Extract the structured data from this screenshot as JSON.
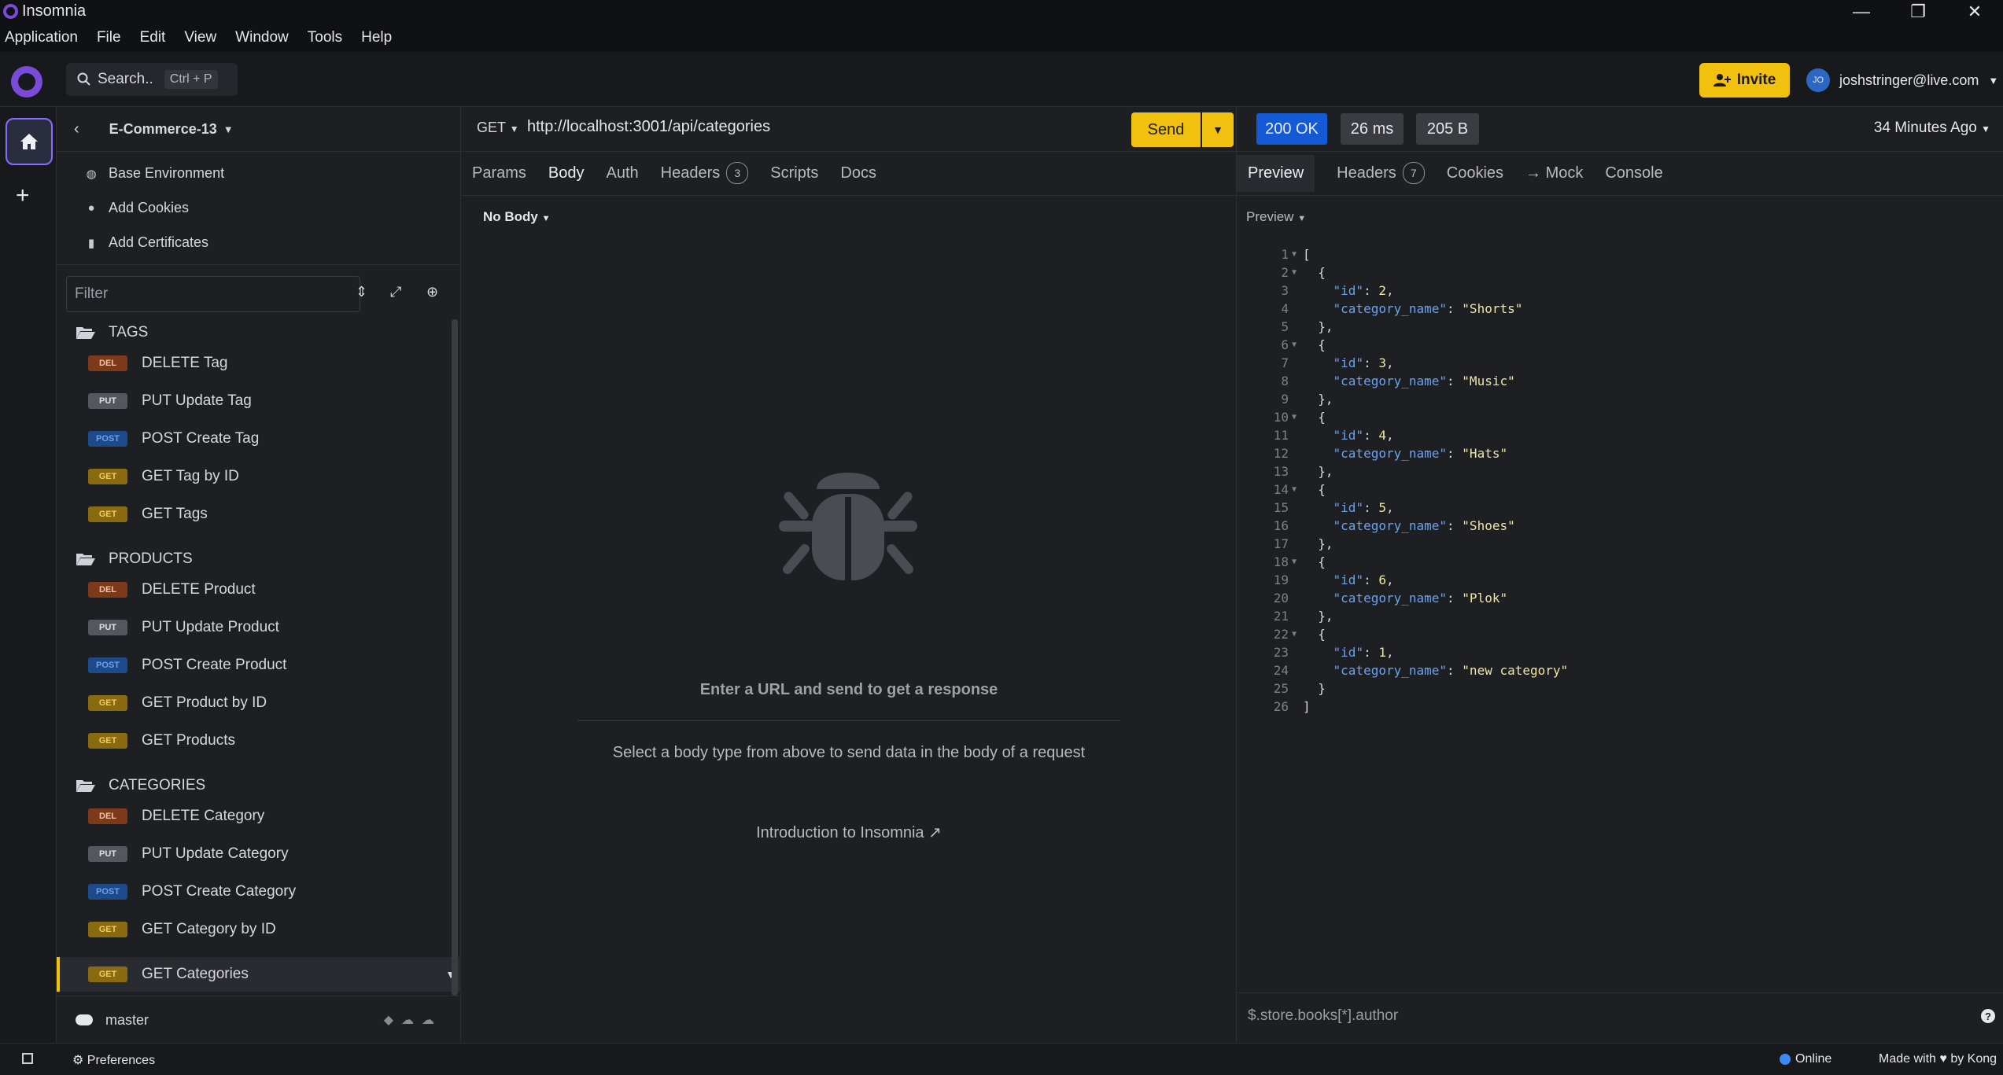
{
  "window": {
    "title": "Insomnia",
    "controls": [
      "—",
      "❐",
      "✕"
    ]
  },
  "menu": [
    "Application",
    "File",
    "Edit",
    "View",
    "Window",
    "Tools",
    "Help"
  ],
  "header": {
    "search_label": "Search..",
    "search_shortcut": "Ctrl + P",
    "invite_label": "Invite",
    "user_initials": "JO",
    "user_email": "joshstringer@live.com"
  },
  "sidebar": {
    "project_name": "E-Commerce-13",
    "env_items": [
      {
        "label": "Base Environment",
        "icon": "globe-icon"
      },
      {
        "label": "Add Cookies",
        "icon": "cookie-icon"
      },
      {
        "label": "Add Certificates",
        "icon": "certificate-icon"
      }
    ],
    "filter_placeholder": "Filter",
    "folders": [
      {
        "name": "TAGS",
        "requests": [
          {
            "method": "DEL",
            "name": "DELETE Tag"
          },
          {
            "method": "PUT",
            "name": "PUT Update Tag"
          },
          {
            "method": "POST",
            "name": "POST Create Tag"
          },
          {
            "method": "GET",
            "name": "GET Tag by ID"
          },
          {
            "method": "GET",
            "name": "GET Tags"
          }
        ]
      },
      {
        "name": "PRODUCTS",
        "requests": [
          {
            "method": "DEL",
            "name": "DELETE Product"
          },
          {
            "method": "PUT",
            "name": "PUT Update Product"
          },
          {
            "method": "POST",
            "name": "POST Create Product"
          },
          {
            "method": "GET",
            "name": "GET Product by ID"
          },
          {
            "method": "GET",
            "name": "GET Products"
          }
        ]
      },
      {
        "name": "CATEGORIES",
        "requests": [
          {
            "method": "DEL",
            "name": "DELETE Category"
          },
          {
            "method": "PUT",
            "name": "PUT Update Category"
          },
          {
            "method": "POST",
            "name": "POST Create Category"
          },
          {
            "method": "GET",
            "name": "GET Category by ID"
          },
          {
            "method": "GET",
            "name": "GET Categories",
            "active": true
          }
        ]
      }
    ],
    "branch": "master"
  },
  "request": {
    "method": "GET",
    "url": "http://localhost:3001/api/categories",
    "send_label": "Send",
    "tabs": [
      {
        "label": "Params"
      },
      {
        "label": "Body",
        "active": true
      },
      {
        "label": "Auth"
      },
      {
        "label": "Headers",
        "count": "3"
      },
      {
        "label": "Scripts"
      },
      {
        "label": "Docs"
      }
    ],
    "body_type": "No Body",
    "empty_title": "Enter a URL and send to get a response",
    "empty_sub": "Select a body type from above to send data in the body of a request",
    "intro_link": "Introduction to Insomnia"
  },
  "response": {
    "status": "200 OK",
    "time": "26 ms",
    "size": "205 B",
    "ago": "34 Minutes Ago",
    "tabs": [
      {
        "label": "Preview",
        "active": true
      },
      {
        "label": "Headers",
        "count": "7"
      },
      {
        "label": "Cookies"
      },
      {
        "label": "→ Mock"
      },
      {
        "label": "Console"
      }
    ],
    "preview_mode": "Preview",
    "items": [
      {
        "id": 2,
        "category_name": "Shorts"
      },
      {
        "id": 3,
        "category_name": "Music"
      },
      {
        "id": 4,
        "category_name": "Hats"
      },
      {
        "id": 5,
        "category_name": "Shoes"
      },
      {
        "id": 6,
        "category_name": "Plok"
      },
      {
        "id": 1,
        "category_name": "new category"
      }
    ],
    "filter_placeholder": "$.store.books[*].author"
  },
  "statusbar": {
    "preferences": "Preferences",
    "online": "Online",
    "made_with": "Made with ♥ by Kong"
  },
  "colors": {
    "accent": "#f2c00e",
    "brand": "#7a4bd8",
    "status_ok": "#1459d6"
  }
}
